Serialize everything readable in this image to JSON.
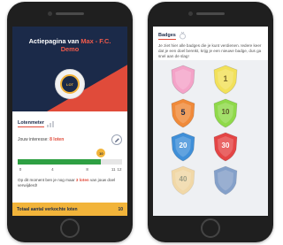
{
  "left_screen": {
    "hero": {
      "title_prefix": "Actiepagina van",
      "title_accent": "Max - F.C.",
      "title_line2": "Demo",
      "crest_text": "LOT"
    },
    "lottery": {
      "section_title": "Lotenmeter",
      "interest_label": "Jouw interesse:",
      "interest_value": "8 loten",
      "marker_value": "10",
      "progress_fraction": 0.8,
      "ticks": [
        "0",
        "4",
        "8",
        "11",
        "12"
      ],
      "hint_prefix": "Op dit moment ben je nog maar",
      "hint_highlight": "3 loten",
      "hint_suffix": "van jouw doel verwijderd!"
    },
    "total": {
      "label": "Totaal aantal verkochte loten",
      "value": "10"
    }
  },
  "right_screen": {
    "title": "Badges",
    "text": "Je ziet hier alle badges die je kunt verdienen. Iedere keer dat je een doel bereikt, krijg je een nieuwe badge, dus ga snel aan de slag!",
    "badges": [
      {
        "number": "",
        "color": "#f4a3c8",
        "locked": false
      },
      {
        "number": "1",
        "color": "#f2e15a",
        "locked": false
      },
      {
        "number": "5",
        "color": "#f08a3a",
        "locked": false
      },
      {
        "number": "10",
        "color": "#8fd94a",
        "locked": false
      },
      {
        "number": "20",
        "color": "#3f8fd8",
        "locked": false
      },
      {
        "number": "30",
        "color": "#e44545",
        "locked": false
      },
      {
        "number": "40",
        "color": "#f4c66a",
        "locked": true
      },
      {
        "number": "",
        "color": "#2f5fa8",
        "locked": true
      }
    ]
  },
  "colors": {
    "navy": "#1b2a49",
    "red": "#e04b3a",
    "gold": "#f2b43a",
    "green": "#2ea043"
  }
}
